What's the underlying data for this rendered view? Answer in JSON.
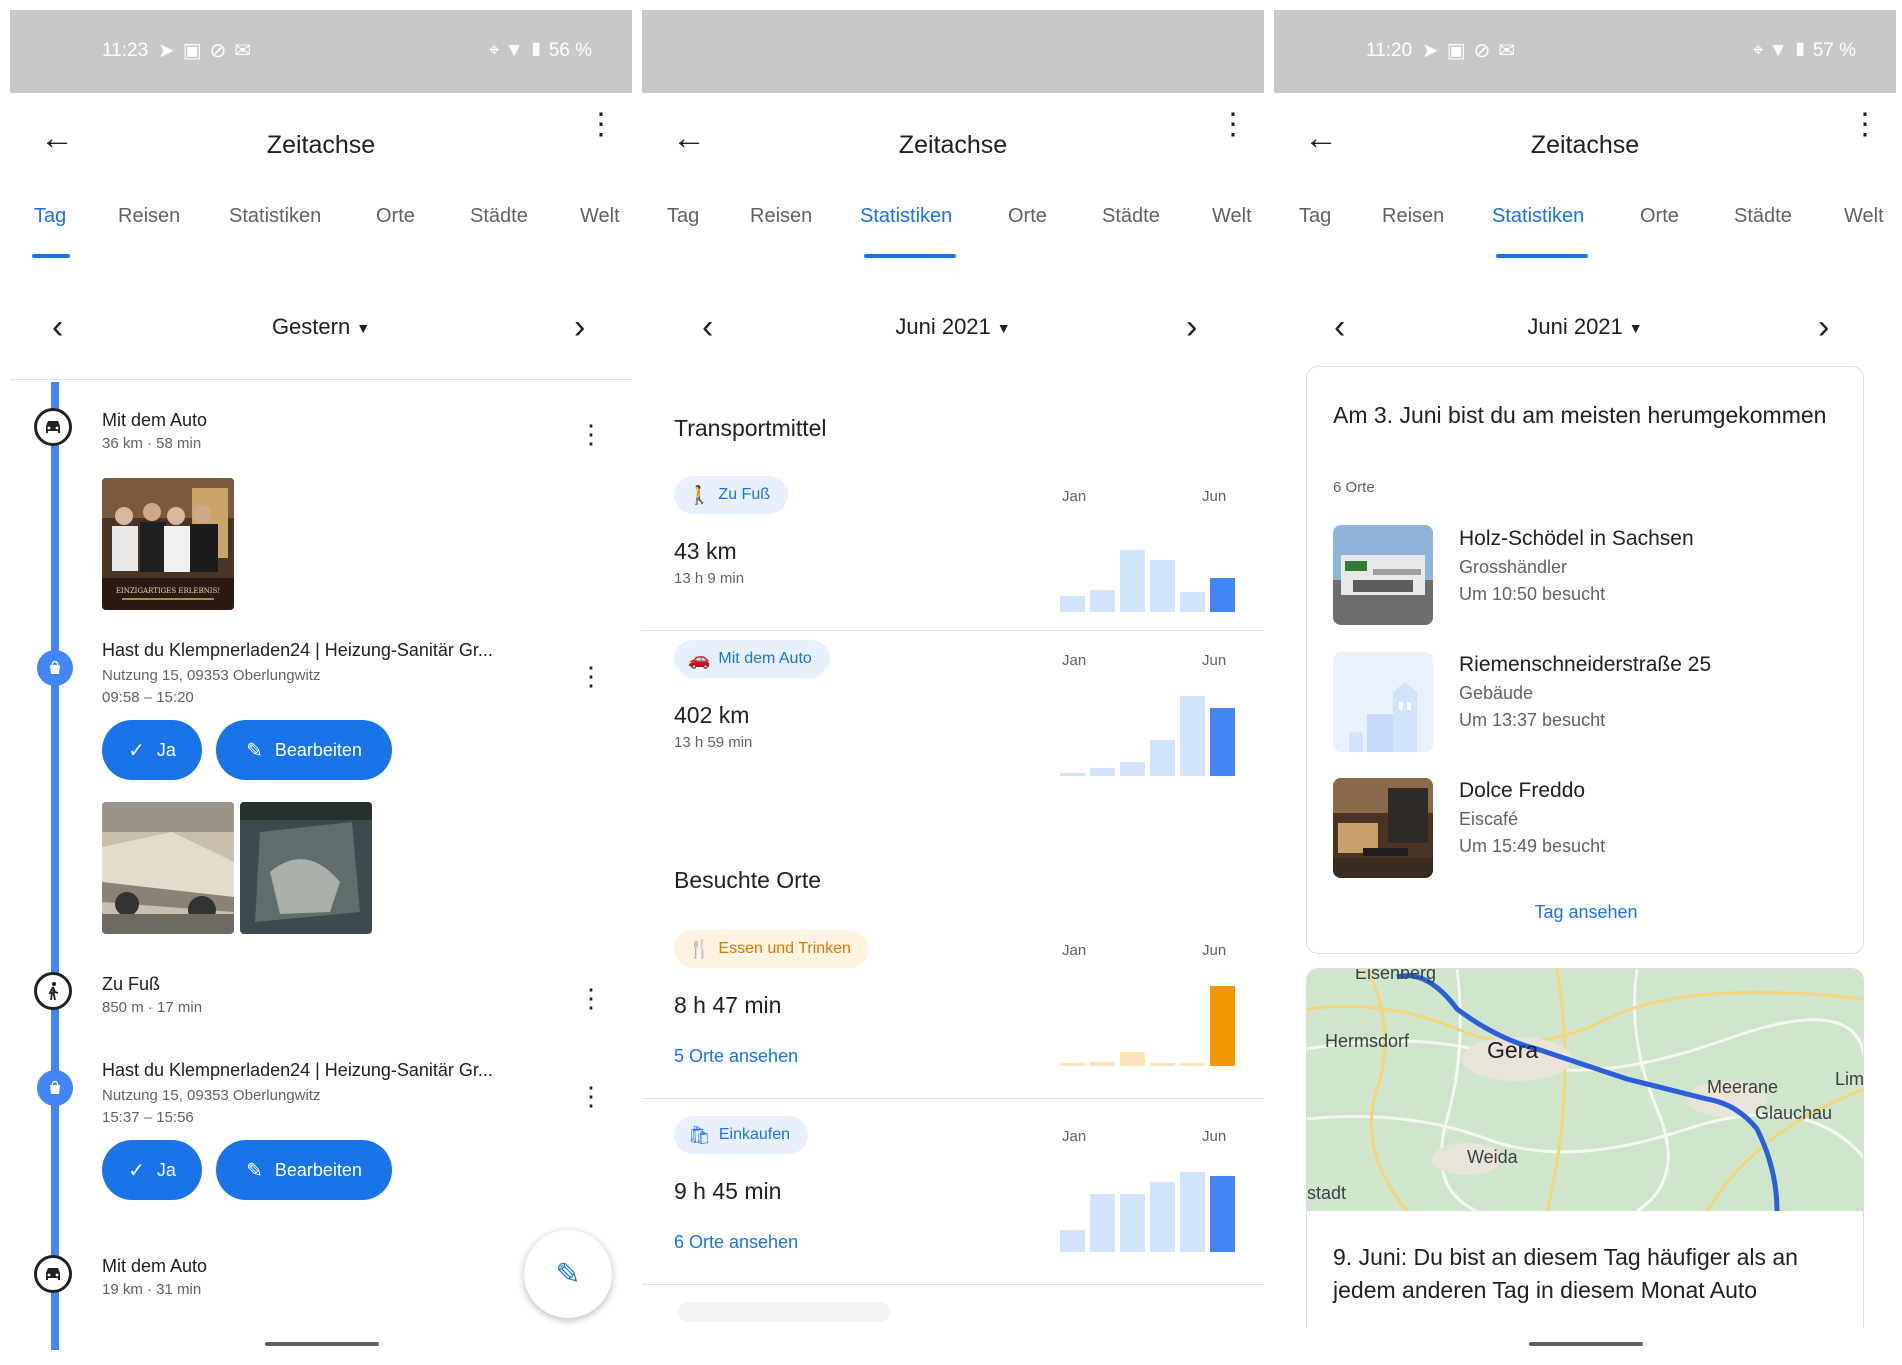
{
  "status_left": {
    "time": "11:23",
    "battery": "56 %"
  },
  "status_right": {
    "time": "11:20",
    "battery": "57 %"
  },
  "screen_title": "Zeitachse",
  "tabs": [
    "Tag",
    "Reisen",
    "Statistiken",
    "Orte",
    "Städte",
    "Welt"
  ],
  "day": {
    "date_label": "Gestern",
    "entries": [
      {
        "title": "Mit dem Auto",
        "sub": "36 km · 58 min",
        "icon": "car-icon"
      },
      {
        "title": "Hast du Klempnerladen24 | Heizung-Sanitär Gr...",
        "address": "Nutzung 15, 09353 Oberlungwitz",
        "time": "09:58 – 15:20",
        "icon": "shopping-bag-icon"
      },
      {
        "title": "Zu Fuß",
        "sub": "850 m · 17 min",
        "icon": "walk-icon"
      },
      {
        "title": "Hast du Klempnerladen24 | Heizung-Sanitär Gr...",
        "address": "Nutzung 15, 09353 Oberlungwitz",
        "time": "15:37 – 15:56",
        "icon": "shopping-bag-icon"
      },
      {
        "title": "Mit dem Auto",
        "sub": "19 km · 31 min",
        "icon": "car-icon"
      }
    ],
    "yes_label": "Ja",
    "edit_label": "Bearbeiten",
    "poster_text": "EINZIGARTIGES ERLEBNIS!"
  },
  "stats": {
    "date_label": "Juni 2021",
    "transport_title": "Transportmittel",
    "visited_title": "Besuchte Orte",
    "axis_start": "Jan",
    "axis_end": "Jun",
    "rows": [
      {
        "chip": "Zu Fuß",
        "icon": "walk-icon",
        "value": "43 km",
        "sub": "13 h 9 min",
        "color": "#4285f4",
        "light": "#d2e3fc",
        "bars": [
          0.2,
          0.28,
          0.78,
          0.65,
          0.25,
          0.42
        ]
      },
      {
        "chip": "Mit dem Auto",
        "icon": "car-icon",
        "value": "402 km",
        "sub": "13 h 59 min",
        "color": "#4285f4",
        "light": "#d2e3fc",
        "bars": [
          0.04,
          0.1,
          0.18,
          0.45,
          1.0,
          0.85
        ]
      },
      {
        "chip": "Essen und Trinken",
        "icon": "restaurant-icon",
        "value": "8 h 47 min",
        "link": "5 Orte ansehen",
        "color": "#f29900",
        "light": "#fde3b5",
        "bars": [
          0.04,
          0.05,
          0.18,
          0.04,
          0.04,
          1.0
        ]
      },
      {
        "chip": "Einkaufen",
        "icon": "shopping-bag-icon",
        "value": "9 h 45 min",
        "link": "6 Orte ansehen",
        "color": "#4285f4",
        "light": "#d2e3fc",
        "bars": [
          0.28,
          0.72,
          0.72,
          0.88,
          1.0,
          0.95
        ]
      }
    ]
  },
  "highlights": {
    "date_label": "Juni 2021",
    "card_title": "Am 3. Juni bist du am meisten herumgekommen",
    "card_count": "6 Orte",
    "places": [
      {
        "name": "Holz-Schödel in Sachsen",
        "type": "Grosshändler",
        "visit": "Um 10:50 besucht"
      },
      {
        "name": "Riemenschneiderstraße 25",
        "type": "Gebäude",
        "visit": "Um 13:37 besucht"
      },
      {
        "name": "Dolce Freddo",
        "type": "Eiscafé",
        "visit": "Um 15:49 besucht"
      }
    ],
    "card_link": "Tag ansehen",
    "map_labels": [
      "Hermsdorf",
      "Gera",
      "Meerane",
      "Glauchau",
      "Weida",
      "stadt",
      "Lim",
      "Eisenberg"
    ],
    "map_text": "9. Juni: Du bist an diesem Tag häufiger als an jedem anderen Tag in diesem Monat Auto"
  }
}
